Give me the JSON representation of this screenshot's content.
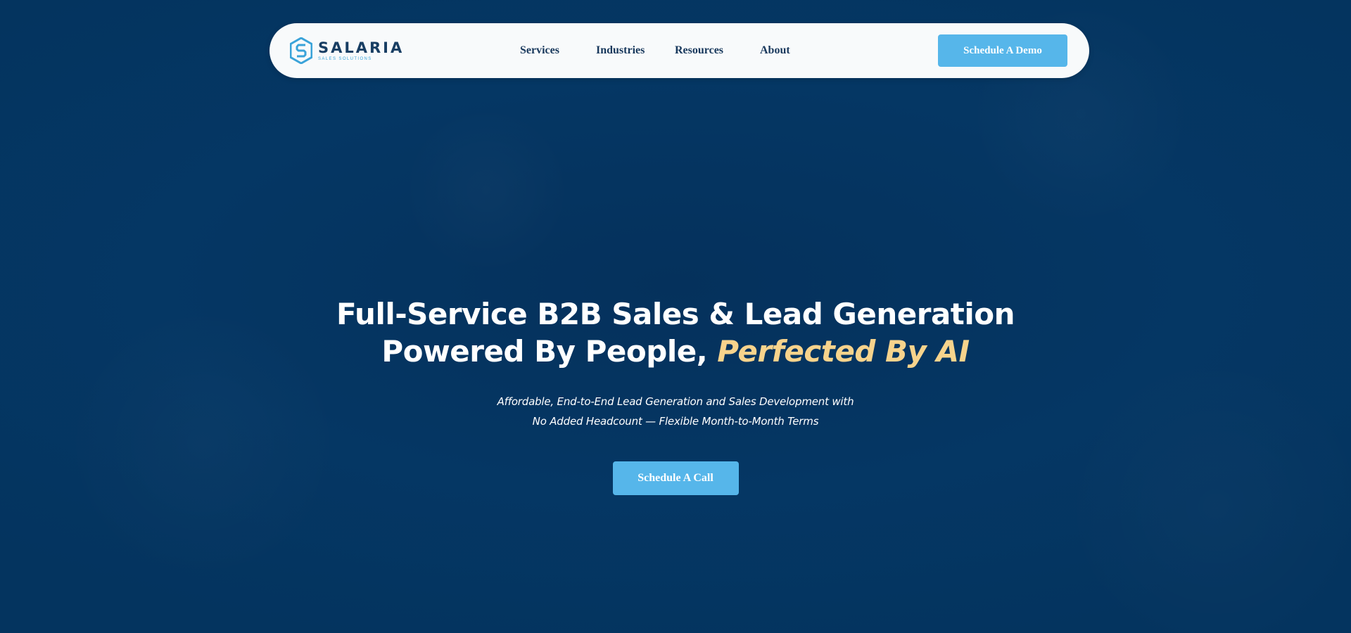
{
  "brand": {
    "name": "SALARIA",
    "tagline": "SALES SOLUTIONS",
    "colors": {
      "navy": "#18385c",
      "accent": "#56b6ea",
      "highlight": "#f7d38c",
      "background": "#04345f"
    }
  },
  "nav": {
    "items": [
      {
        "label": "Services"
      },
      {
        "label": "Industries"
      },
      {
        "label": "Resources"
      },
      {
        "label": "About"
      }
    ],
    "cta_label": "Schedule A Demo"
  },
  "hero": {
    "title_line1": "Full-Service B2B Sales & Lead Generation",
    "title_line2_plain": "Powered By People, ",
    "title_line2_accent": "Perfected By AI",
    "subtitle_line1": "Affordable, End-to-End Lead Generation and Sales Development with",
    "subtitle_line2": "No Added Headcount — Flexible Month-to-Month Terms",
    "cta_label": "Schedule A Call"
  },
  "icons": {
    "logo": "hexagon-s-logo-icon"
  }
}
